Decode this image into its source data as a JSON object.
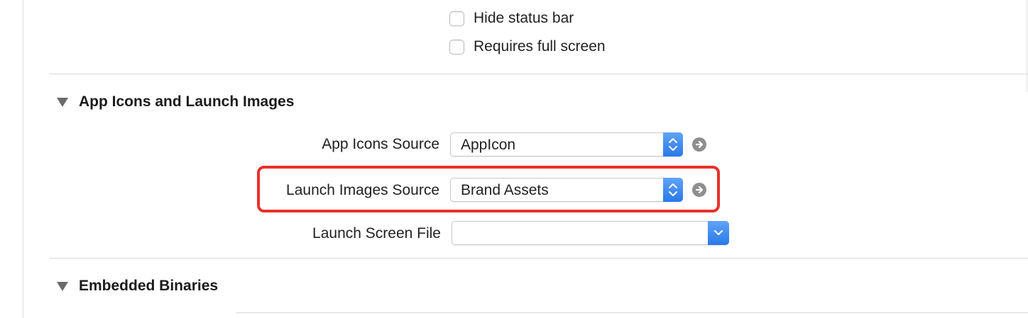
{
  "checkboxes": {
    "hide_status_bar": {
      "label": "Hide status bar",
      "checked": false
    },
    "requires_full_screen": {
      "label": "Requires full screen",
      "checked": false
    }
  },
  "sections": {
    "app_icons": {
      "title": "App Icons and Launch Images"
    },
    "embedded": {
      "title": "Embedded Binaries"
    }
  },
  "fields": {
    "app_icons_source": {
      "label": "App Icons Source",
      "value": "AppIcon"
    },
    "launch_images_source": {
      "label": "Launch Images Source",
      "value": "Brand Assets"
    },
    "launch_screen_file": {
      "label": "Launch Screen File",
      "value": ""
    }
  },
  "icons": {
    "disclosure": "disclosure-triangle-icon",
    "stepper": "up-down-chevron-icon",
    "goto": "arrow-circle-right-icon",
    "dropdown": "chevron-down-icon"
  },
  "colors": {
    "accent_blue": "#2a79e8",
    "highlight_red": "#e8302a",
    "goto_gray": "#8e8e8e"
  }
}
